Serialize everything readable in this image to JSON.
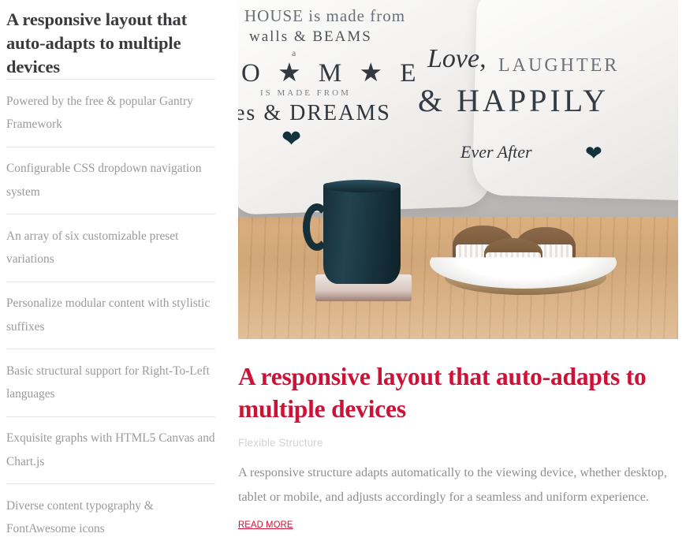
{
  "left_panel": {
    "title": "A responsive layout that auto-adapts to multiple devices",
    "items": [
      {
        "label": "Powered by the free & popular Gantry Framework"
      },
      {
        "label": "Configurable CSS dropdown navigation system"
      },
      {
        "label": "An array of six customizable preset variations"
      },
      {
        "label": "Personalize modular content with stylistic suffixes"
      },
      {
        "label": "Basic structural support for Right-To-Left languages"
      },
      {
        "label": "Exquisite graphs with HTML5 Canvas and Chart.js"
      },
      {
        "label": "Diverse content typography & FontAwesome icons"
      }
    ]
  },
  "right_panel": {
    "photo": {
      "alt": "Dark navy mug and three muffins on a white plate on a wooden table, in front of a sofa with white printed pillows",
      "pillow_left": {
        "line1": "HOUSE is made from",
        "line2": "walls & BEAMS",
        "line3": "a",
        "line4": "O ★ M ★ E",
        "line5": "IS MADE FROM",
        "line6": "es & DREAMS"
      },
      "pillow_right": {
        "line1": "Love,",
        "line2": "LAUGHTER",
        "line3": "& HAPPILY",
        "line4": "Ever After"
      }
    },
    "heading": "A responsive layout that auto-adapts to multiple devices",
    "subtitle": "Flexible Structure",
    "body": "A responsive structure adapts automatically to the viewing device, whether desktop, tablet or mobile, and adjusts accordingly for a seamless and uniform experience.",
    "read_more_label": "Read More"
  },
  "colors": {
    "accent_red": "#cc1236",
    "heading_dark": "#3a3a3c",
    "body_gray": "#8e8e93",
    "muted_gray": "#9a9a9e",
    "subtitle_gray": "#d3d3d5",
    "divider": "#e6e6e8",
    "background": "#ffffff"
  }
}
